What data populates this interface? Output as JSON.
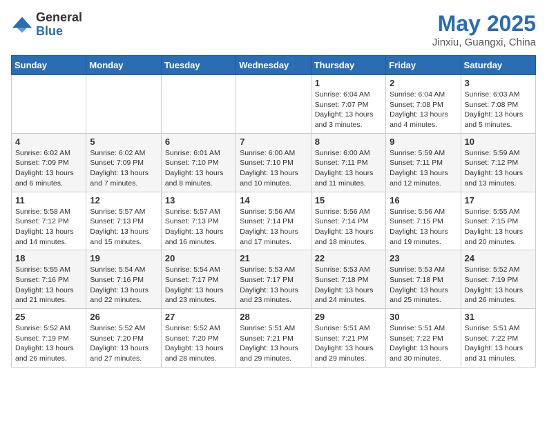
{
  "logo": {
    "general": "General",
    "blue": "Blue"
  },
  "title": {
    "month": "May 2025",
    "location": "Jinxiu, Guangxi, China"
  },
  "weekdays": [
    "Sunday",
    "Monday",
    "Tuesday",
    "Wednesday",
    "Thursday",
    "Friday",
    "Saturday"
  ],
  "weeks": [
    [
      {
        "day": "",
        "info": ""
      },
      {
        "day": "",
        "info": ""
      },
      {
        "day": "",
        "info": ""
      },
      {
        "day": "",
        "info": ""
      },
      {
        "day": "1",
        "info": "Sunrise: 6:04 AM\nSunset: 7:07 PM\nDaylight: 13 hours\nand 3 minutes."
      },
      {
        "day": "2",
        "info": "Sunrise: 6:04 AM\nSunset: 7:08 PM\nDaylight: 13 hours\nand 4 minutes."
      },
      {
        "day": "3",
        "info": "Sunrise: 6:03 AM\nSunset: 7:08 PM\nDaylight: 13 hours\nand 5 minutes."
      }
    ],
    [
      {
        "day": "4",
        "info": "Sunrise: 6:02 AM\nSunset: 7:09 PM\nDaylight: 13 hours\nand 6 minutes."
      },
      {
        "day": "5",
        "info": "Sunrise: 6:02 AM\nSunset: 7:09 PM\nDaylight: 13 hours\nand 7 minutes."
      },
      {
        "day": "6",
        "info": "Sunrise: 6:01 AM\nSunset: 7:10 PM\nDaylight: 13 hours\nand 8 minutes."
      },
      {
        "day": "7",
        "info": "Sunrise: 6:00 AM\nSunset: 7:10 PM\nDaylight: 13 hours\nand 10 minutes."
      },
      {
        "day": "8",
        "info": "Sunrise: 6:00 AM\nSunset: 7:11 PM\nDaylight: 13 hours\nand 11 minutes."
      },
      {
        "day": "9",
        "info": "Sunrise: 5:59 AM\nSunset: 7:11 PM\nDaylight: 13 hours\nand 12 minutes."
      },
      {
        "day": "10",
        "info": "Sunrise: 5:59 AM\nSunset: 7:12 PM\nDaylight: 13 hours\nand 13 minutes."
      }
    ],
    [
      {
        "day": "11",
        "info": "Sunrise: 5:58 AM\nSunset: 7:12 PM\nDaylight: 13 hours\nand 14 minutes."
      },
      {
        "day": "12",
        "info": "Sunrise: 5:57 AM\nSunset: 7:13 PM\nDaylight: 13 hours\nand 15 minutes."
      },
      {
        "day": "13",
        "info": "Sunrise: 5:57 AM\nSunset: 7:13 PM\nDaylight: 13 hours\nand 16 minutes."
      },
      {
        "day": "14",
        "info": "Sunrise: 5:56 AM\nSunset: 7:14 PM\nDaylight: 13 hours\nand 17 minutes."
      },
      {
        "day": "15",
        "info": "Sunrise: 5:56 AM\nSunset: 7:14 PM\nDaylight: 13 hours\nand 18 minutes."
      },
      {
        "day": "16",
        "info": "Sunrise: 5:56 AM\nSunset: 7:15 PM\nDaylight: 13 hours\nand 19 minutes."
      },
      {
        "day": "17",
        "info": "Sunrise: 5:55 AM\nSunset: 7:15 PM\nDaylight: 13 hours\nand 20 minutes."
      }
    ],
    [
      {
        "day": "18",
        "info": "Sunrise: 5:55 AM\nSunset: 7:16 PM\nDaylight: 13 hours\nand 21 minutes."
      },
      {
        "day": "19",
        "info": "Sunrise: 5:54 AM\nSunset: 7:16 PM\nDaylight: 13 hours\nand 22 minutes."
      },
      {
        "day": "20",
        "info": "Sunrise: 5:54 AM\nSunset: 7:17 PM\nDaylight: 13 hours\nand 23 minutes."
      },
      {
        "day": "21",
        "info": "Sunrise: 5:53 AM\nSunset: 7:17 PM\nDaylight: 13 hours\nand 23 minutes."
      },
      {
        "day": "22",
        "info": "Sunrise: 5:53 AM\nSunset: 7:18 PM\nDaylight: 13 hours\nand 24 minutes."
      },
      {
        "day": "23",
        "info": "Sunrise: 5:53 AM\nSunset: 7:18 PM\nDaylight: 13 hours\nand 25 minutes."
      },
      {
        "day": "24",
        "info": "Sunrise: 5:52 AM\nSunset: 7:19 PM\nDaylight: 13 hours\nand 26 minutes."
      }
    ],
    [
      {
        "day": "25",
        "info": "Sunrise: 5:52 AM\nSunset: 7:19 PM\nDaylight: 13 hours\nand 26 minutes."
      },
      {
        "day": "26",
        "info": "Sunrise: 5:52 AM\nSunset: 7:20 PM\nDaylight: 13 hours\nand 27 minutes."
      },
      {
        "day": "27",
        "info": "Sunrise: 5:52 AM\nSunset: 7:20 PM\nDaylight: 13 hours\nand 28 minutes."
      },
      {
        "day": "28",
        "info": "Sunrise: 5:51 AM\nSunset: 7:21 PM\nDaylight: 13 hours\nand 29 minutes."
      },
      {
        "day": "29",
        "info": "Sunrise: 5:51 AM\nSunset: 7:21 PM\nDaylight: 13 hours\nand 29 minutes."
      },
      {
        "day": "30",
        "info": "Sunrise: 5:51 AM\nSunset: 7:22 PM\nDaylight: 13 hours\nand 30 minutes."
      },
      {
        "day": "31",
        "info": "Sunrise: 5:51 AM\nSunset: 7:22 PM\nDaylight: 13 hours\nand 31 minutes."
      }
    ]
  ]
}
